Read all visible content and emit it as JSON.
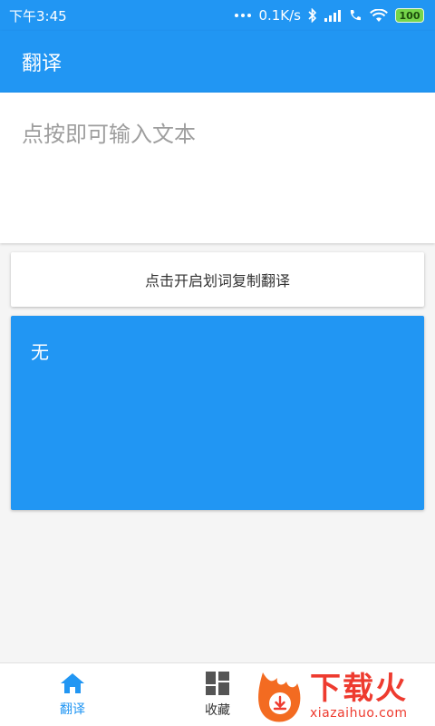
{
  "status_bar": {
    "time": "下午3:45",
    "network_speed": "0.1K/s",
    "battery": "100"
  },
  "app_bar": {
    "title": "翻译"
  },
  "input": {
    "placeholder": "点按即可输入文本"
  },
  "toggle": {
    "label": "点击开启划词复制翻译"
  },
  "result": {
    "text": "无"
  },
  "bottom_nav": {
    "items": [
      {
        "label": "翻译",
        "icon": "home-icon",
        "active": true
      },
      {
        "label": "收藏",
        "icon": "dashboard-icon",
        "active": false
      }
    ]
  },
  "watermark": {
    "cn": "下载火",
    "en": "xiazaihuo.com"
  },
  "colors": {
    "primary": "#2196f3",
    "background": "#f5f5f5",
    "watermark": "#ee3b2f"
  }
}
